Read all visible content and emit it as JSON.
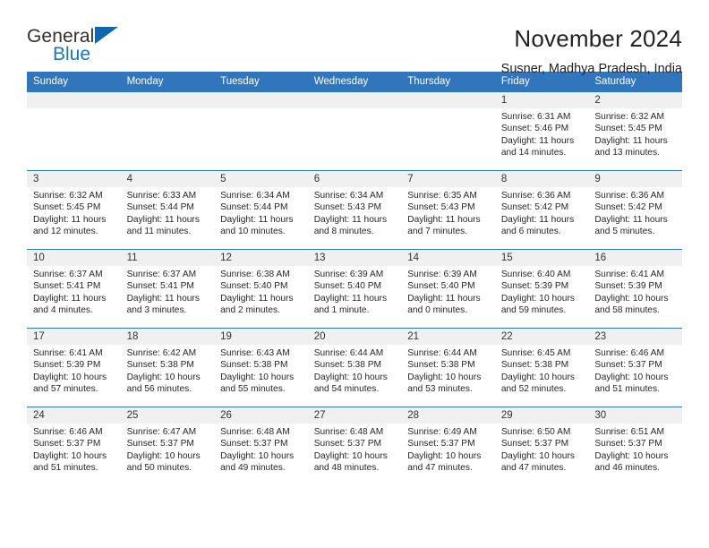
{
  "brand": {
    "name_part1": "General",
    "name_part2": "Blue",
    "triangle_icon": "triangle-logo-icon",
    "color_text": "#33302e",
    "color_blue": "#1277c4"
  },
  "header": {
    "title": "November 2024",
    "subtitle": "Susner, Madhya Pradesh, India"
  },
  "theme": {
    "header_bar": "#3176bc",
    "daynum_band": "#f0f0f0",
    "text": "#262626"
  },
  "calendar": {
    "weekday_headers": [
      "Sunday",
      "Monday",
      "Tuesday",
      "Wednesday",
      "Thursday",
      "Friday",
      "Saturday"
    ],
    "weeks": [
      [
        {
          "day": "",
          "sunrise": "",
          "sunset": "",
          "daylight": ""
        },
        {
          "day": "",
          "sunrise": "",
          "sunset": "",
          "daylight": ""
        },
        {
          "day": "",
          "sunrise": "",
          "sunset": "",
          "daylight": ""
        },
        {
          "day": "",
          "sunrise": "",
          "sunset": "",
          "daylight": ""
        },
        {
          "day": "",
          "sunrise": "",
          "sunset": "",
          "daylight": ""
        },
        {
          "day": "1",
          "sunrise": "Sunrise: 6:31 AM",
          "sunset": "Sunset: 5:46 PM",
          "daylight": "Daylight: 11 hours and 14 minutes."
        },
        {
          "day": "2",
          "sunrise": "Sunrise: 6:32 AM",
          "sunset": "Sunset: 5:45 PM",
          "daylight": "Daylight: 11 hours and 13 minutes."
        }
      ],
      [
        {
          "day": "3",
          "sunrise": "Sunrise: 6:32 AM",
          "sunset": "Sunset: 5:45 PM",
          "daylight": "Daylight: 11 hours and 12 minutes."
        },
        {
          "day": "4",
          "sunrise": "Sunrise: 6:33 AM",
          "sunset": "Sunset: 5:44 PM",
          "daylight": "Daylight: 11 hours and 11 minutes."
        },
        {
          "day": "5",
          "sunrise": "Sunrise: 6:34 AM",
          "sunset": "Sunset: 5:44 PM",
          "daylight": "Daylight: 11 hours and 10 minutes."
        },
        {
          "day": "6",
          "sunrise": "Sunrise: 6:34 AM",
          "sunset": "Sunset: 5:43 PM",
          "daylight": "Daylight: 11 hours and 8 minutes."
        },
        {
          "day": "7",
          "sunrise": "Sunrise: 6:35 AM",
          "sunset": "Sunset: 5:43 PM",
          "daylight": "Daylight: 11 hours and 7 minutes."
        },
        {
          "day": "8",
          "sunrise": "Sunrise: 6:36 AM",
          "sunset": "Sunset: 5:42 PM",
          "daylight": "Daylight: 11 hours and 6 minutes."
        },
        {
          "day": "9",
          "sunrise": "Sunrise: 6:36 AM",
          "sunset": "Sunset: 5:42 PM",
          "daylight": "Daylight: 11 hours and 5 minutes."
        }
      ],
      [
        {
          "day": "10",
          "sunrise": "Sunrise: 6:37 AM",
          "sunset": "Sunset: 5:41 PM",
          "daylight": "Daylight: 11 hours and 4 minutes."
        },
        {
          "day": "11",
          "sunrise": "Sunrise: 6:37 AM",
          "sunset": "Sunset: 5:41 PM",
          "daylight": "Daylight: 11 hours and 3 minutes."
        },
        {
          "day": "12",
          "sunrise": "Sunrise: 6:38 AM",
          "sunset": "Sunset: 5:40 PM",
          "daylight": "Daylight: 11 hours and 2 minutes."
        },
        {
          "day": "13",
          "sunrise": "Sunrise: 6:39 AM",
          "sunset": "Sunset: 5:40 PM",
          "daylight": "Daylight: 11 hours and 1 minute."
        },
        {
          "day": "14",
          "sunrise": "Sunrise: 6:39 AM",
          "sunset": "Sunset: 5:40 PM",
          "daylight": "Daylight: 11 hours and 0 minutes."
        },
        {
          "day": "15",
          "sunrise": "Sunrise: 6:40 AM",
          "sunset": "Sunset: 5:39 PM",
          "daylight": "Daylight: 10 hours and 59 minutes."
        },
        {
          "day": "16",
          "sunrise": "Sunrise: 6:41 AM",
          "sunset": "Sunset: 5:39 PM",
          "daylight": "Daylight: 10 hours and 58 minutes."
        }
      ],
      [
        {
          "day": "17",
          "sunrise": "Sunrise: 6:41 AM",
          "sunset": "Sunset: 5:39 PM",
          "daylight": "Daylight: 10 hours and 57 minutes."
        },
        {
          "day": "18",
          "sunrise": "Sunrise: 6:42 AM",
          "sunset": "Sunset: 5:38 PM",
          "daylight": "Daylight: 10 hours and 56 minutes."
        },
        {
          "day": "19",
          "sunrise": "Sunrise: 6:43 AM",
          "sunset": "Sunset: 5:38 PM",
          "daylight": "Daylight: 10 hours and 55 minutes."
        },
        {
          "day": "20",
          "sunrise": "Sunrise: 6:44 AM",
          "sunset": "Sunset: 5:38 PM",
          "daylight": "Daylight: 10 hours and 54 minutes."
        },
        {
          "day": "21",
          "sunrise": "Sunrise: 6:44 AM",
          "sunset": "Sunset: 5:38 PM",
          "daylight": "Daylight: 10 hours and 53 minutes."
        },
        {
          "day": "22",
          "sunrise": "Sunrise: 6:45 AM",
          "sunset": "Sunset: 5:38 PM",
          "daylight": "Daylight: 10 hours and 52 minutes."
        },
        {
          "day": "23",
          "sunrise": "Sunrise: 6:46 AM",
          "sunset": "Sunset: 5:37 PM",
          "daylight": "Daylight: 10 hours and 51 minutes."
        }
      ],
      [
        {
          "day": "24",
          "sunrise": "Sunrise: 6:46 AM",
          "sunset": "Sunset: 5:37 PM",
          "daylight": "Daylight: 10 hours and 51 minutes."
        },
        {
          "day": "25",
          "sunrise": "Sunrise: 6:47 AM",
          "sunset": "Sunset: 5:37 PM",
          "daylight": "Daylight: 10 hours and 50 minutes."
        },
        {
          "day": "26",
          "sunrise": "Sunrise: 6:48 AM",
          "sunset": "Sunset: 5:37 PM",
          "daylight": "Daylight: 10 hours and 49 minutes."
        },
        {
          "day": "27",
          "sunrise": "Sunrise: 6:48 AM",
          "sunset": "Sunset: 5:37 PM",
          "daylight": "Daylight: 10 hours and 48 minutes."
        },
        {
          "day": "28",
          "sunrise": "Sunrise: 6:49 AM",
          "sunset": "Sunset: 5:37 PM",
          "daylight": "Daylight: 10 hours and 47 minutes."
        },
        {
          "day": "29",
          "sunrise": "Sunrise: 6:50 AM",
          "sunset": "Sunset: 5:37 PM",
          "daylight": "Daylight: 10 hours and 47 minutes."
        },
        {
          "day": "30",
          "sunrise": "Sunrise: 6:51 AM",
          "sunset": "Sunset: 5:37 PM",
          "daylight": "Daylight: 10 hours and 46 minutes."
        }
      ]
    ]
  }
}
